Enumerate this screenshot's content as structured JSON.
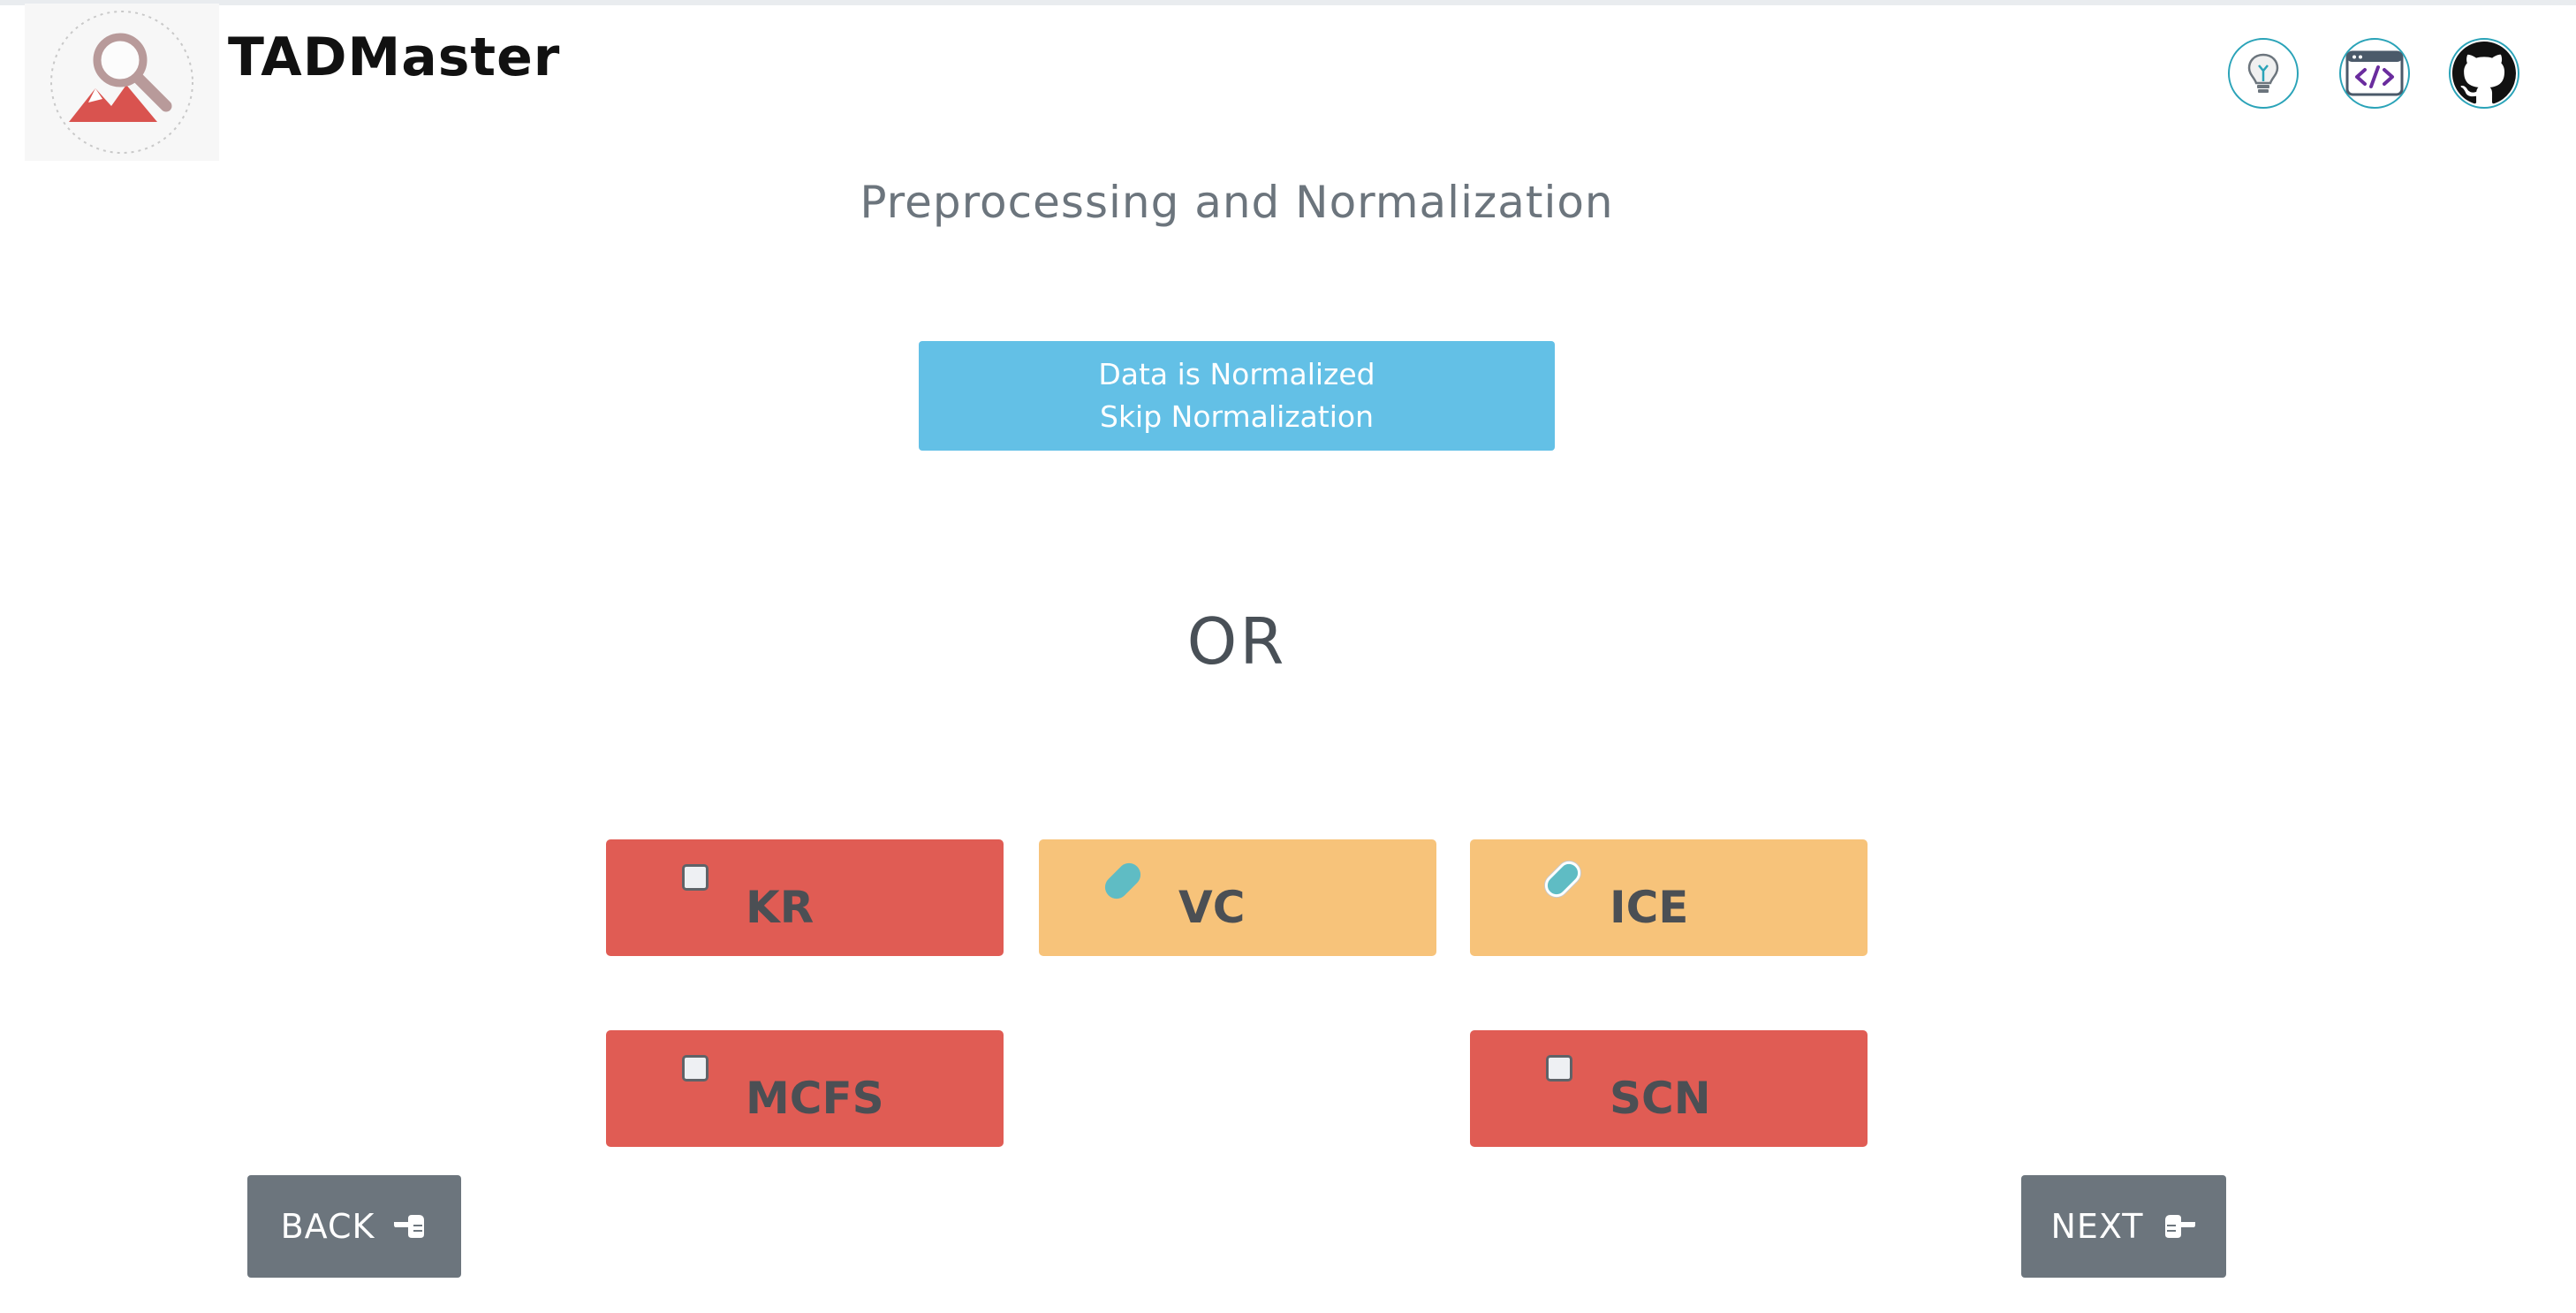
{
  "header": {
    "brand": "TADMaster",
    "icons": [
      "lightbulb-icon",
      "code-window-icon",
      "github-icon"
    ]
  },
  "main": {
    "title": "Preprocessing and Normalization",
    "normalized_button": {
      "line1": "Data is Normalized",
      "line2": "Skip Normalization"
    },
    "or_label": "OR",
    "methods": [
      {
        "label": "KR",
        "selected": false,
        "color": "#e05c54"
      },
      {
        "label": "VC",
        "selected": true,
        "color": "#f7c37a"
      },
      {
        "label": "ICE",
        "selected": true,
        "color": "#f7c37a"
      },
      {
        "label": "MCFS",
        "selected": false,
        "color": "#e05c54"
      },
      {
        "label": "SCN",
        "selected": false,
        "color": "#e05c54"
      }
    ]
  },
  "footer": {
    "back_label": "BACK",
    "next_label": "NEXT"
  },
  "colors": {
    "accent_blue": "#63c0e6",
    "unselected_red": "#e05c54",
    "selected_orange": "#f7c37a",
    "nav_gray": "#6c757d",
    "icon_border": "#2aa3b8"
  }
}
